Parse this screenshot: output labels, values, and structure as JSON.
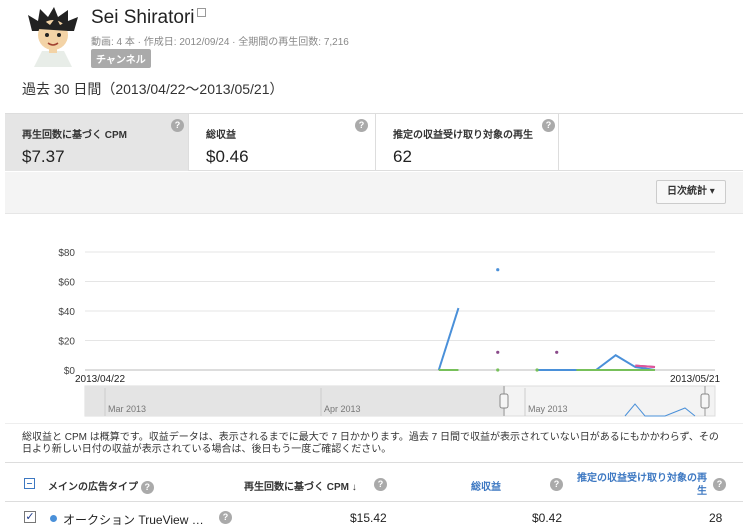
{
  "channel": {
    "name": "Sei Shiratori",
    "meta": "動画: 4 本 · 作成日: 2012/09/24 · 全期間の再生回数: 7,216",
    "badge": "チャンネル"
  },
  "period": "過去 30 日間（2013/04/22〜2013/05/21）",
  "metrics": [
    {
      "label": "再生回数に基づく CPM",
      "value": "$7.37",
      "selected": true
    },
    {
      "label": "総収益",
      "value": "$0.46",
      "selected": false
    },
    {
      "label": "推定の収益受け取り対象の再生",
      "value": "62",
      "selected": false
    }
  ],
  "help_glyph": "?",
  "daily_button": {
    "label": "日次統計",
    "caret": "▾"
  },
  "chart_data": {
    "type": "line",
    "y_ticks": [
      "$80",
      "$60",
      "$40",
      "$20",
      "$0"
    ],
    "ylim": [
      0,
      80
    ],
    "x_start_label": "2013/04/22",
    "x_end_label": "2013/05/21",
    "dates": [
      "04/22",
      "04/23",
      "04/24",
      "04/25",
      "04/26",
      "04/27",
      "04/28",
      "04/29",
      "04/30",
      "05/01",
      "05/02",
      "05/03",
      "05/04",
      "05/05",
      "05/06",
      "05/07",
      "05/08",
      "05/09",
      "05/10",
      "05/11",
      "05/12",
      "05/13",
      "05/14",
      "05/15",
      "05/16",
      "05/17",
      "05/18",
      "05/19",
      "05/20",
      "05/21"
    ],
    "series": [
      {
        "color": "#4a90d9",
        "values": [
          null,
          null,
          null,
          null,
          null,
          null,
          null,
          null,
          null,
          null,
          null,
          null,
          null,
          null,
          null,
          null,
          null,
          null,
          0,
          42,
          null,
          68,
          null,
          0,
          0,
          0,
          0,
          10,
          2,
          0
        ]
      },
      {
        "color": "#77c05a",
        "values": [
          null,
          null,
          null,
          null,
          null,
          null,
          null,
          null,
          null,
          null,
          null,
          null,
          null,
          null,
          null,
          null,
          null,
          null,
          0,
          0,
          null,
          0,
          null,
          0,
          null,
          0,
          0,
          0,
          0,
          0
        ]
      },
      {
        "color": "#8a4a8a",
        "values": [
          null,
          null,
          null,
          null,
          null,
          null,
          null,
          null,
          null,
          null,
          null,
          null,
          null,
          null,
          null,
          null,
          null,
          null,
          null,
          null,
          null,
          12,
          null,
          null,
          12,
          null,
          null,
          null,
          3,
          2
        ]
      },
      {
        "color": "#e0559b",
        "values": [
          null,
          null,
          null,
          null,
          null,
          null,
          null,
          null,
          null,
          null,
          null,
          null,
          null,
          null,
          null,
          null,
          null,
          null,
          null,
          null,
          null,
          null,
          null,
          null,
          null,
          null,
          null,
          null,
          3,
          2
        ]
      }
    ],
    "navigator_labels": [
      "Mar 2013",
      "Apr 2013",
      "May 2013"
    ]
  },
  "note": "総収益と CPM は概算です。収益データは、表示されるまでに最大で 7 日かかります。過去 7 日間で収益が表示されていない日があるにもかかわらず、その日より新しい日付の収益が表示されている場合は、後日もう一度ご確認ください。",
  "table": {
    "headers": {
      "ad_type": "メインの広告タイプ",
      "cpm": "再生回数に基づく CPM",
      "sort_arrow": "↓",
      "revenue": "総収益",
      "monetized_line1": "推定の収益受け取り対象の再",
      "monetized_line2": "生"
    },
    "rows": [
      {
        "checked": "✓",
        "ad_type": "オークション TrueView …",
        "cpm": "$15.42",
        "revenue": "$0.42",
        "monetized": "28"
      }
    ]
  }
}
